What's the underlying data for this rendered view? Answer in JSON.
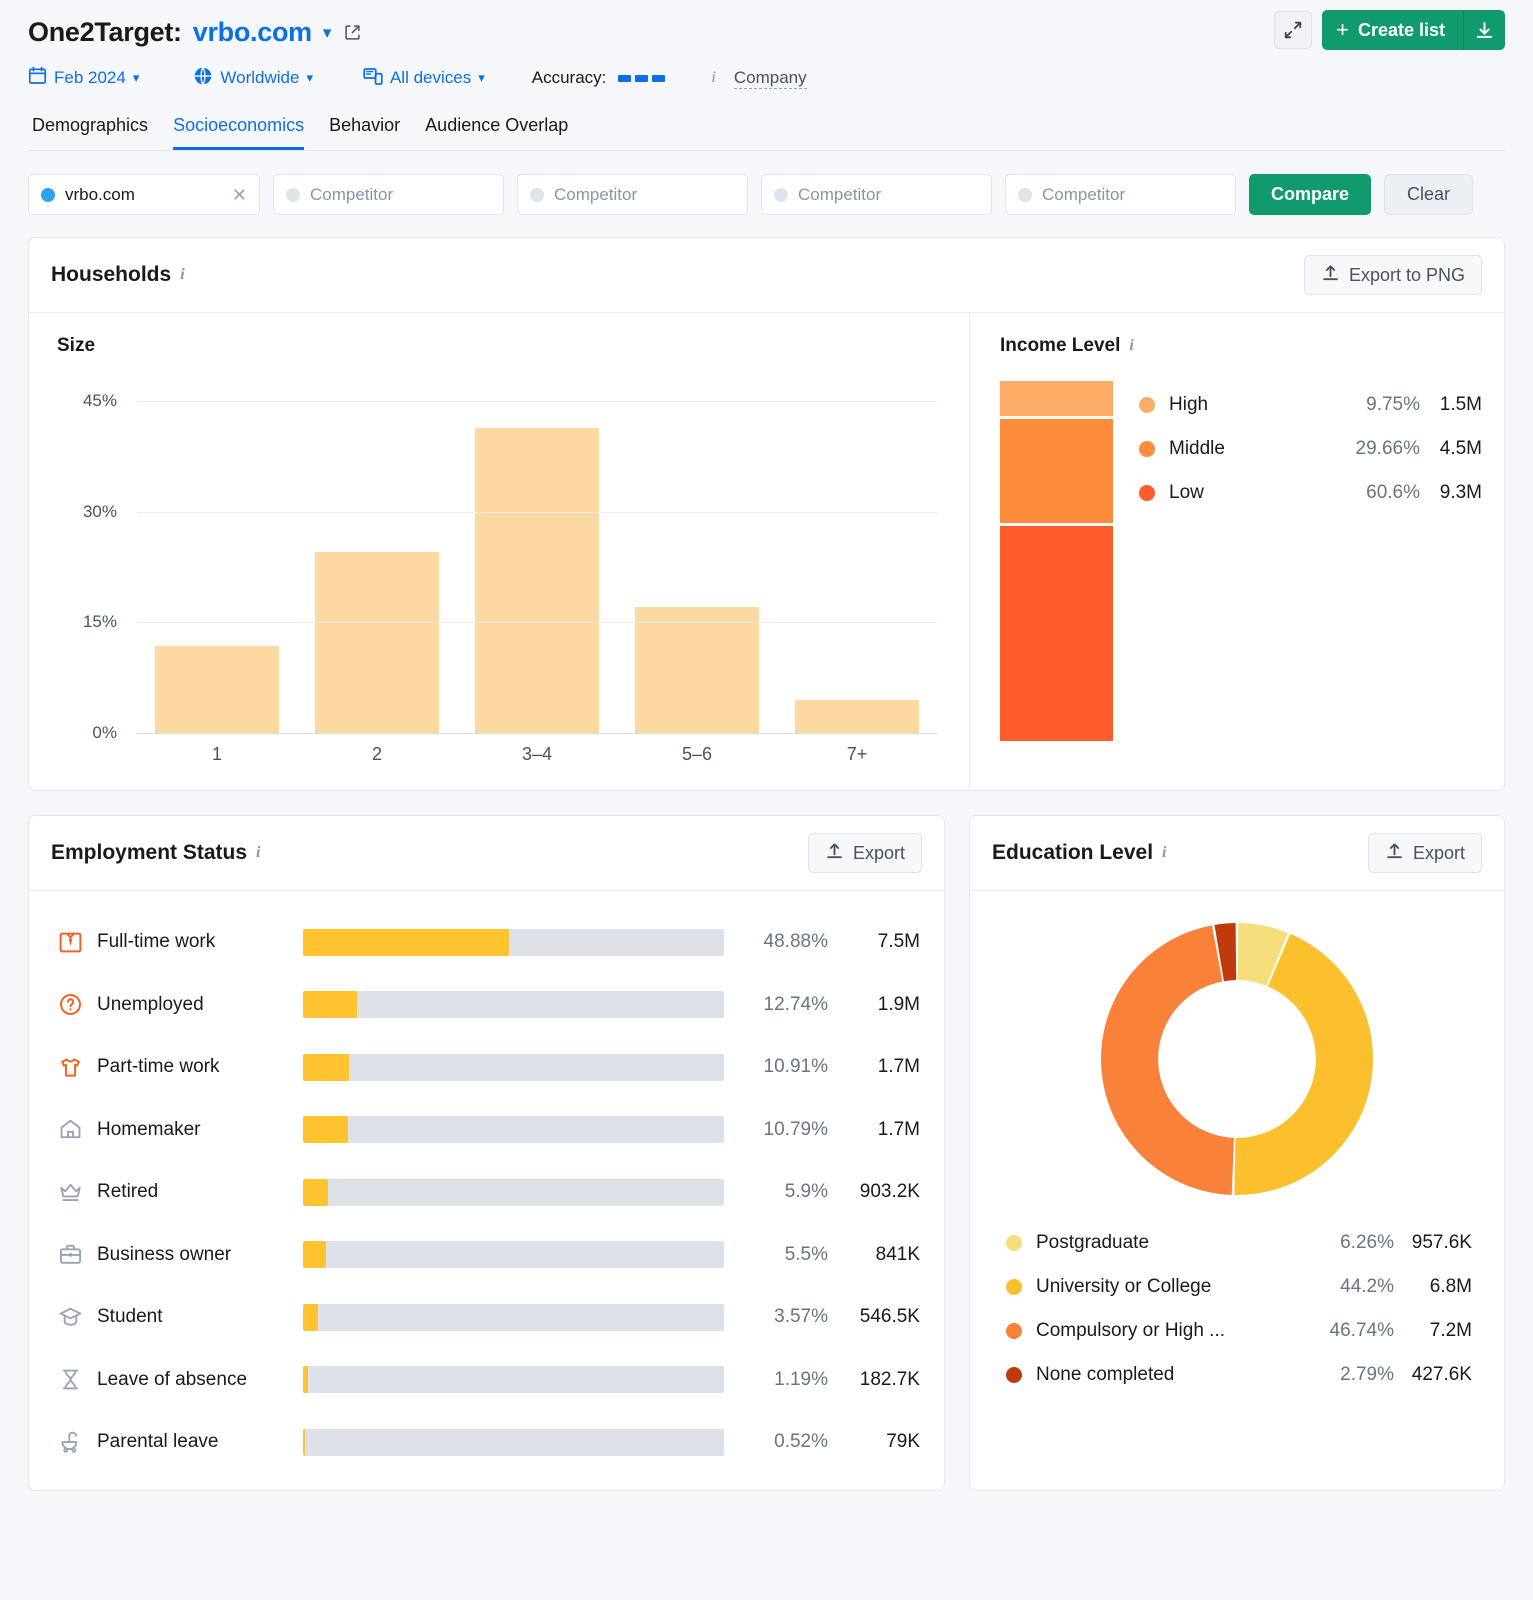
{
  "header": {
    "title_prefix": "One2Target:",
    "domain": "vrbo.com",
    "filters": [
      {
        "icon": "calendar-icon",
        "label": "Feb 2024"
      },
      {
        "icon": "globe-icon",
        "label": "Worldwide"
      },
      {
        "icon": "devices-icon",
        "label": "All devices"
      }
    ],
    "accuracy_label": "Accuracy:",
    "accuracy_bars": 3,
    "company_link": "Company",
    "expand_icon": "expand-icon",
    "create_list_label": "Create list",
    "download_icon": "download-icon"
  },
  "tabs": [
    {
      "label": "Demographics",
      "active": false
    },
    {
      "label": "Socioeconomics",
      "active": true
    },
    {
      "label": "Behavior",
      "active": false
    },
    {
      "label": "Audience Overlap",
      "active": false
    }
  ],
  "competitors": {
    "selected": "vrbo.com",
    "placeholder": "Competitor",
    "slots": 4,
    "compare_label": "Compare",
    "clear_label": "Clear"
  },
  "households": {
    "title": "Households",
    "export_label": "Export to PNG",
    "size_title": "Size",
    "income_title": "Income Level"
  },
  "employment": {
    "title": "Employment Status",
    "export_label": "Export",
    "rows": [
      {
        "icon": "shirt-tie-icon",
        "label": "Full-time work",
        "pct": "48.88%",
        "pct_value": 48.88,
        "abs": "7.5M"
      },
      {
        "icon": "question-circle-icon",
        "label": "Unemployed",
        "pct": "12.74%",
        "pct_value": 12.74,
        "abs": "1.9M"
      },
      {
        "icon": "tshirt-icon",
        "label": "Part-time work",
        "pct": "10.91%",
        "pct_value": 10.91,
        "abs": "1.7M"
      },
      {
        "icon": "home-icon",
        "label": "Homemaker",
        "pct": "10.79%",
        "pct_value": 10.79,
        "abs": "1.7M"
      },
      {
        "icon": "crown-icon",
        "label": "Retired",
        "pct": "5.9%",
        "pct_value": 5.9,
        "abs": "903.2K"
      },
      {
        "icon": "briefcase-icon",
        "label": "Business owner",
        "pct": "5.5%",
        "pct_value": 5.5,
        "abs": "841K"
      },
      {
        "icon": "graduation-cap-icon",
        "label": "Student",
        "pct": "3.57%",
        "pct_value": 3.57,
        "abs": "546.5K"
      },
      {
        "icon": "hourglass-icon",
        "label": "Leave of absence",
        "pct": "1.19%",
        "pct_value": 1.19,
        "abs": "182.7K"
      },
      {
        "icon": "stroller-icon",
        "label": "Parental leave",
        "pct": "0.52%",
        "pct_value": 0.52,
        "abs": "79K"
      }
    ]
  },
  "education": {
    "title": "Education Level",
    "export_label": "Export"
  },
  "colors": {
    "brand_blue": "#0d6fe5",
    "brand_green": "#119a6e",
    "bar_peach": "#fcd9a0",
    "bar_yellow": "#ffc330",
    "track_gray": "#dfe1e9",
    "income_high": "#ffad66",
    "income_middle": "#ff8b3d",
    "income_low": "#ff5c2b",
    "edu_postgrad": "#f7de7d",
    "edu_university": "#fcc02e",
    "edu_compulsory": "#f9813a",
    "edu_none": "#c13a0d"
  },
  "chart_data": [
    {
      "type": "bar",
      "title": "Size",
      "categories": [
        "1",
        "2",
        "3–4",
        "5–6",
        "7+"
      ],
      "values": [
        11.8,
        24.6,
        41.4,
        17.1,
        4.5
      ],
      "xlabel": "",
      "ylabel": "",
      "ylim": [
        0,
        48
      ],
      "yticks": [
        "0%",
        "15%",
        "30%",
        "45%"
      ],
      "ytick_values": [
        0,
        15,
        30,
        45
      ],
      "grid": true,
      "legend": "none",
      "color": "#fcd9a0"
    },
    {
      "type": "bar",
      "subtype": "stacked-vertical",
      "title": "Income Level",
      "categories": [
        "High",
        "Middle",
        "Low"
      ],
      "values": [
        9.75,
        29.66,
        60.6
      ],
      "value_labels": [
        "9.75%",
        "29.66%",
        "60.6%"
      ],
      "absolute_labels": [
        "1.5M",
        "4.5M",
        "9.3M"
      ],
      "colors": [
        "#ffad66",
        "#ff8b3d",
        "#ff5c2b"
      ],
      "legend": "right"
    },
    {
      "type": "bar",
      "subtype": "horizontal-progress",
      "title": "Employment Status",
      "categories": [
        "Full-time work",
        "Unemployed",
        "Part-time work",
        "Homemaker",
        "Retired",
        "Business owner",
        "Student",
        "Leave of absence",
        "Parental leave"
      ],
      "values": [
        48.88,
        12.74,
        10.91,
        10.79,
        5.9,
        5.5,
        3.57,
        1.19,
        0.52
      ],
      "value_labels": [
        "48.88%",
        "12.74%",
        "10.91%",
        "10.79%",
        "5.9%",
        "5.5%",
        "3.57%",
        "1.19%",
        "0.52%"
      ],
      "absolute_labels": [
        "7.5M",
        "1.9M",
        "1.7M",
        "1.7M",
        "903.2K",
        "841K",
        "546.5K",
        "182.7K",
        "79K"
      ],
      "xlim": [
        0,
        100
      ],
      "color": "#ffc330",
      "track_color": "#dfe1e9",
      "legend": "none"
    },
    {
      "type": "pie",
      "subtype": "donut",
      "title": "Education Level",
      "categories": [
        "Postgraduate",
        "University or College",
        "Compulsory or High ...",
        "None completed"
      ],
      "values": [
        6.26,
        44.2,
        46.74,
        2.79
      ],
      "value_labels": [
        "6.26%",
        "44.2%",
        "46.74%",
        "2.79%"
      ],
      "absolute_labels": [
        "957.6K",
        "6.8M",
        "7.2M",
        "427.6K"
      ],
      "colors": [
        "#f7de7d",
        "#fcc02e",
        "#f9813a",
        "#c13a0d"
      ],
      "legend": "bottom",
      "start_angle": 0,
      "inner_radius_ratio": 0.58
    }
  ]
}
